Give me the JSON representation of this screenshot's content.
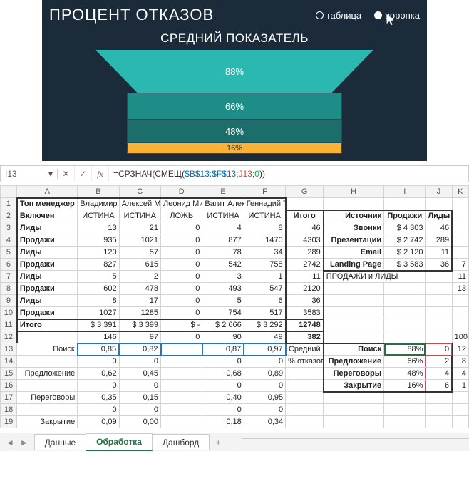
{
  "chart": {
    "title": "ПРОЦЕНТ ОТКАЗОВ",
    "subtitle": "СРЕДНИЙ ПОКАЗАТЕЛЬ",
    "toggle": {
      "table": "таблица",
      "funnel": "воронка",
      "selected": "funnel"
    }
  },
  "chart_data": {
    "type": "funnel",
    "title": "СРЕДНИЙ ПОКАЗАТЕЛЬ",
    "categories": [
      "Поиск",
      "Предложение",
      "Переговоры",
      "Закрытие"
    ],
    "values": [
      88,
      66,
      48,
      16
    ],
    "ylabel": "",
    "xlabel": "",
    "colors": [
      "#2bb8b0",
      "#1f8d87",
      "#1c6e6a",
      "#f9b233"
    ]
  },
  "formula_bar": {
    "name_box": "I13",
    "formula_prefix": "=СРЗНАЧ(СМЕЩ(",
    "ref1": "$B$13:$F$13",
    "sep1": ";",
    "ref2": "J13",
    "sep2": ";",
    "ref3": "0",
    "suffix": "))"
  },
  "cols": [
    "A",
    "B",
    "C",
    "D",
    "E",
    "F",
    "G",
    "H",
    "I",
    "J",
    "K"
  ],
  "rows": {
    "r1": {
      "A": "Топ менеджер",
      "B": "Владимир Лисин",
      "C": "Алексей Мордаш",
      "D": "Леонид Михель",
      "E": "Вагит Алекпе",
      "F": "Геннадий Тимченк"
    },
    "r2": {
      "A": "Включен",
      "B": "ИСТИНА",
      "C": "ИСТИНА",
      "D": "ЛОЖЬ",
      "E": "ИСТИНА",
      "F": "ИСТИНА",
      "G": "Итого",
      "H": "Источник",
      "I": "Продажи",
      "J": "Лиды"
    },
    "r3": {
      "A": "Лиды",
      "B": "13",
      "C": "21",
      "D": "0",
      "E": "4",
      "F": "8",
      "G": "46",
      "H": "Звонки",
      "I": "$   4 303",
      "J": "46"
    },
    "r4": {
      "A": "Продажи",
      "B": "935",
      "C": "1021",
      "D": "0",
      "E": "877",
      "F": "1470",
      "G": "4303",
      "H": "Презентации",
      "I": "$   2 742",
      "J": "289"
    },
    "r5": {
      "A": "Лиды",
      "B": "120",
      "C": "57",
      "D": "0",
      "E": "78",
      "F": "34",
      "G": "289",
      "H": "Email",
      "I": "$   2 120",
      "J": "11"
    },
    "r6": {
      "A": "Продажи",
      "B": "827",
      "C": "615",
      "D": "0",
      "E": "542",
      "F": "758",
      "G": "2742",
      "H": "Landing Page",
      "I": "$   3 583",
      "J": "36",
      "K": "7"
    },
    "r7": {
      "A": "Лиды",
      "B": "5",
      "C": "2",
      "D": "0",
      "E": "3",
      "F": "1",
      "G": "11",
      "H": "ПРОДАЖИ и ЛИДЫ",
      "K": "11"
    },
    "r8": {
      "A": "Продажи",
      "B": "602",
      "C": "478",
      "D": "0",
      "E": "493",
      "F": "547",
      "G": "2120",
      "K": "13"
    },
    "r9": {
      "A": "Лиды",
      "B": "8",
      "C": "17",
      "D": "0",
      "E": "5",
      "F": "6",
      "G": "36"
    },
    "r10": {
      "A": "Продажи",
      "B": "1027",
      "C": "1285",
      "D": "0",
      "E": "754",
      "F": "517",
      "G": "3583"
    },
    "r11": {
      "A": "Итого",
      "B": "$   3 391",
      "C": "$   3 399",
      "D": "$   -",
      "E": "$ 2 666",
      "F": "$   3 292",
      "G": "12748"
    },
    "r12": {
      "B": "146",
      "C": "97",
      "D": "0",
      "E": "90",
      "F": "49",
      "G": "382",
      "K": "100"
    },
    "r13": {
      "A": "Поиск",
      "B": "0,85",
      "C": "0,82",
      "E": "0,87",
      "F": "0,97",
      "G": "Средний",
      "H": "Поиск",
      "I": "88%",
      "J": "0",
      "K": "12"
    },
    "r14": {
      "B": "0",
      "C": "0",
      "E": "0",
      "F": "0",
      "G": "% отказов",
      "H": "Предложение",
      "I": "66%",
      "J": "2",
      "K": "8"
    },
    "r15": {
      "A": "Предложение",
      "B": "0,62",
      "C": "0,45",
      "E": "0,68",
      "F": "0,89",
      "H": "Переговоры",
      "I": "48%",
      "J": "4",
      "K": "4"
    },
    "r16": {
      "B": "0",
      "C": "0",
      "E": "0",
      "F": "0",
      "H": "Закрытие",
      "I": "16%",
      "J": "6",
      "K": "1"
    },
    "r17": {
      "A": "Переговоры",
      "B": "0,35",
      "C": "0,15",
      "E": "0,40",
      "F": "0,95"
    },
    "r18": {
      "B": "0",
      "C": "0",
      "E": "0",
      "F": "0"
    },
    "r19": {
      "A": "Закрытие",
      "B": "0,09",
      "C": "0,00",
      "E": "0,18",
      "F": "0,34"
    }
  },
  "tabs": {
    "t1": "Данные",
    "t2": "Обработка",
    "t3": "Дашборд",
    "active": "t2",
    "add": "+"
  }
}
